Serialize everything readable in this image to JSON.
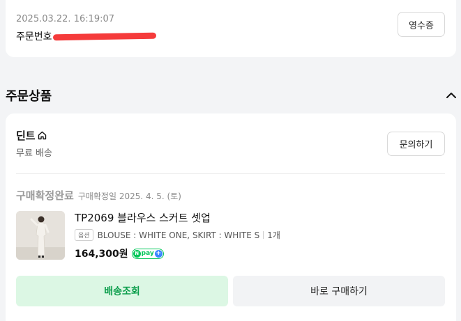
{
  "order": {
    "datetime": "2025.03.22. 16:19:07",
    "number_label": "주문번호",
    "receipt_label": "영수증"
  },
  "section": {
    "title": "주문상품"
  },
  "shop": {
    "name": "딘트",
    "shipping": "무료 배송",
    "inquiry_label": "문의하기"
  },
  "item": {
    "status": "구매확정완료",
    "status_date": "구매확정일 2025. 4. 5. (토)",
    "name": "TP2069 블라우스 스커트 셋업",
    "option_badge": "옵션",
    "option_text": "BLOUSE : WHITE ONE, SKIRT : WHITE S",
    "quantity": "1개",
    "price": "164,300원",
    "npay_text": "pay"
  },
  "actions": {
    "track_label": "배송조회",
    "buy_again_label": "바로 구매하기"
  },
  "colors": {
    "accent_green": "#03c75a",
    "track_bg": "#dcf7e4",
    "redaction": "#f53b3b"
  }
}
